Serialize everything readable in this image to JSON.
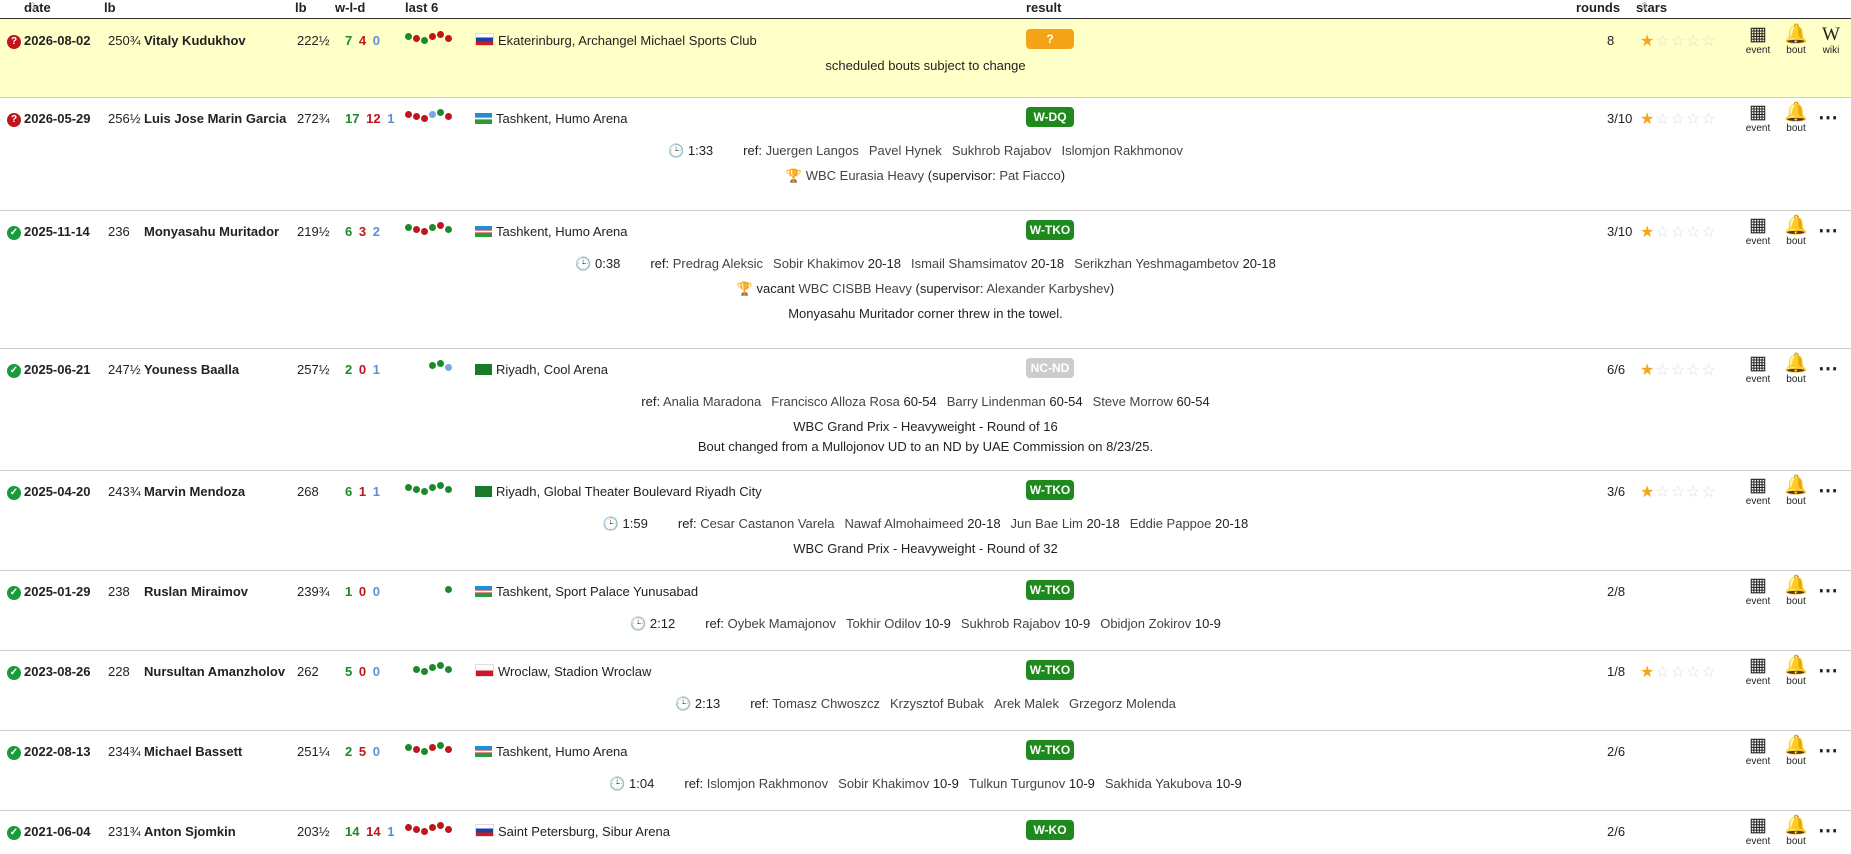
{
  "header": {
    "date": "date",
    "lb": "lb",
    "opp_lb": "lb",
    "wld": "w-l-d",
    "last6": "last 6",
    "result": "result",
    "rounds": "rounds",
    "stars": "stars"
  },
  "icons": {
    "event": "event",
    "bout": "bout",
    "wiki": "wiki",
    "more": "more-icon"
  },
  "bouts": [
    {
      "status": "scheduled",
      "date": "2026-08-02",
      "lb": "250¾",
      "opponent": "Vitaly Kudukhov",
      "opp_lb": "222½",
      "w": "7",
      "l": "4",
      "d": "0",
      "last6": [
        "W",
        "L",
        "W",
        "L",
        "L",
        "L"
      ],
      "flag": "ru",
      "venue": "Ekaterinburg, Archangel Michael Sports Club",
      "result": "?",
      "rounds": "8",
      "stars": 1,
      "wiki": true,
      "lines": [
        "scheduled bouts subject to change"
      ]
    },
    {
      "status": "scheduled",
      "date": "2026-05-29",
      "lb": "256½",
      "opponent": "Luis Jose Marin Garcia",
      "opp_lb": "272¾",
      "w": "17",
      "l": "12",
      "d": "1",
      "last6": [
        "L",
        "L",
        "L",
        "D",
        "W",
        "L"
      ],
      "flag": "uz",
      "venue": "Tashkent, Humo Arena",
      "result": "W-DQ",
      "rounds": "3/10",
      "stars": 1,
      "time": "1:33",
      "referee": "Juergen Langos",
      "judges": [
        {
          "name": "Pavel Hynek",
          "score": ""
        },
        {
          "name": "Sukhrob Rajabov",
          "score": ""
        },
        {
          "name": "Islomjon Rakhmonov",
          "score": ""
        }
      ],
      "title": {
        "prefix": "",
        "name": "WBC Eurasia Heavy",
        "supervisor": "Pat Fiacco"
      }
    },
    {
      "status": "done",
      "date": "2025-11-14",
      "lb": "236",
      "opponent": "Monyasahu Muritador",
      "opp_lb": "219½",
      "w": "6",
      "l": "3",
      "d": "2",
      "last6": [
        "W",
        "L",
        "L",
        "W",
        "L",
        "W"
      ],
      "flag": "uz",
      "venue": "Tashkent, Humo Arena",
      "result": "W-TKO",
      "rounds": "3/10",
      "stars": 1,
      "time": "0:38",
      "referee": "Predrag Aleksic",
      "judges": [
        {
          "name": "Sobir Khakimov",
          "score": "20-18"
        },
        {
          "name": "Ismail Shamsimatov",
          "score": "20-18"
        },
        {
          "name": "Serikzhan Yeshmagambetov",
          "score": "20-18"
        }
      ],
      "title": {
        "prefix": "vacant",
        "name": "WBC CISBB Heavy",
        "supervisor": "Alexander Karbyshev"
      },
      "lines": [
        "Monyasahu Muritador corner threw in the towel."
      ]
    },
    {
      "status": "done",
      "date": "2025-06-21",
      "lb": "247½",
      "opponent": "Youness Baalla",
      "opp_lb": "257½",
      "w": "2",
      "l": "0",
      "d": "1",
      "last6": [
        "W",
        "W",
        "D"
      ],
      "flag": "sa",
      "venue": "Riyadh, Cool Arena",
      "result": "NC-ND",
      "rounds": "6/6",
      "stars": 1,
      "time": "",
      "referee": "Analia Maradona",
      "judges": [
        {
          "name": "Francisco Alloza Rosa",
          "score": "60-54"
        },
        {
          "name": "Barry Lindenman",
          "score": "60-54"
        },
        {
          "name": "Steve Morrow",
          "score": "60-54"
        }
      ],
      "lines": [
        "WBC Grand Prix - Heavyweight - Round of 16",
        "Bout changed from a Mullojonov UD to an ND by UAE Commission on 8/23/25."
      ]
    },
    {
      "status": "done",
      "date": "2025-04-20",
      "lb": "243¾",
      "opponent": "Marvin Mendoza",
      "opp_lb": "268",
      "w": "6",
      "l": "1",
      "d": "1",
      "last6": [
        "W",
        "W",
        "W",
        "W",
        "W",
        "W"
      ],
      "flag": "sa",
      "venue": "Riyadh, Global Theater Boulevard Riyadh City",
      "result": "W-TKO",
      "rounds": "3/6",
      "stars": 1,
      "time": "1:59",
      "referee": "Cesar Castanon Varela",
      "judges": [
        {
          "name": "Nawaf Almohaimeed",
          "score": "20-18"
        },
        {
          "name": "Jun Bae Lim",
          "score": "20-18"
        },
        {
          "name": "Eddie Pappoe",
          "score": "20-18"
        }
      ],
      "lines": [
        "WBC Grand Prix - Heavyweight - Round of 32"
      ]
    },
    {
      "status": "done",
      "date": "2025-01-29",
      "lb": "238",
      "opponent": "Ruslan Miraimov",
      "opp_lb": "239¾",
      "w": "1",
      "l": "0",
      "d": "0",
      "last6": [
        "W"
      ],
      "flag": "uz",
      "venue": "Tashkent, Sport Palace Yunusabad",
      "result": "W-TKO",
      "rounds": "2/8",
      "stars": 0,
      "time": "2:12",
      "referee": "Oybek Mamajonov",
      "judges": [
        {
          "name": "Tokhir Odilov",
          "score": "10-9"
        },
        {
          "name": "Sukhrob Rajabov",
          "score": "10-9"
        },
        {
          "name": "Obidjon Zokirov",
          "score": "10-9"
        }
      ]
    },
    {
      "status": "done",
      "date": "2023-08-26",
      "lb": "228",
      "opponent": "Nursultan Amanzholov",
      "opp_lb": "262",
      "w": "5",
      "l": "0",
      "d": "0",
      "last6": [
        "W",
        "W",
        "W",
        "W",
        "W"
      ],
      "flag": "pl",
      "venue": "Wroclaw, Stadion Wroclaw",
      "result": "W-TKO",
      "rounds": "1/8",
      "stars": 1,
      "time": "2:13",
      "referee": "Tomasz Chwoszcz",
      "judges": [
        {
          "name": "Krzysztof Bubak",
          "score": ""
        },
        {
          "name": "Arek Malek",
          "score": ""
        },
        {
          "name": "Grzegorz Molenda",
          "score": ""
        }
      ]
    },
    {
      "status": "done",
      "date": "2022-08-13",
      "lb": "234¾",
      "opponent": "Michael Bassett",
      "opp_lb": "251¼",
      "w": "2",
      "l": "5",
      "d": "0",
      "last6": [
        "W",
        "L",
        "W",
        "L",
        "W",
        "L"
      ],
      "flag": "uz",
      "venue": "Tashkent, Humo Arena",
      "result": "W-TKO",
      "rounds": "2/6",
      "stars": 0,
      "time": "1:04",
      "referee": "Islomjon Rakhmonov",
      "judges": [
        {
          "name": "Sobir Khakimov",
          "score": "10-9"
        },
        {
          "name": "Tulkun Turgunov",
          "score": "10-9"
        },
        {
          "name": "Sakhida Yakubova",
          "score": "10-9"
        }
      ]
    },
    {
      "status": "done",
      "date": "2021-06-04",
      "lb": "231¾",
      "opponent": "Anton Sjomkin",
      "opp_lb": "203½",
      "w": "14",
      "l": "14",
      "d": "1",
      "last6": [
        "L",
        "L",
        "L",
        "L",
        "L",
        "L"
      ],
      "flag": "ru",
      "venue": "Saint Petersburg, Sibur Arena",
      "result": "W-KO",
      "rounds": "2/6",
      "stars": 0
    }
  ]
}
